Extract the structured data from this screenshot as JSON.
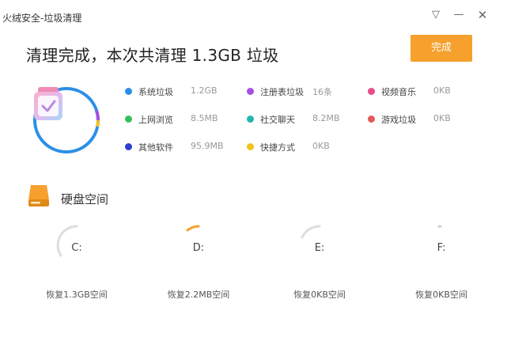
{
  "window": {
    "title": "火绒安全-垃圾清理",
    "menu_glyph": "▽",
    "minimize_glyph": "—",
    "close_glyph": "✕"
  },
  "summary": {
    "headline": "清理完成，本次共清理 1.3GB 垃圾",
    "done_label": "完成"
  },
  "categories": [
    {
      "label": "系统垃圾",
      "value": "1.2GB",
      "color": "#2b8fe8"
    },
    {
      "label": "注册表垃圾",
      "value": "16条",
      "color": "#a64fe3"
    },
    {
      "label": "视频音乐",
      "value": "0KB",
      "color": "#e84a8a"
    },
    {
      "label": "上网浏览",
      "value": "8.5MB",
      "color": "#34c15a"
    },
    {
      "label": "社交聊天",
      "value": "8.2MB",
      "color": "#23b6ad"
    },
    {
      "label": "游戏垃圾",
      "value": "0KB",
      "color": "#e45a5a"
    },
    {
      "label": "其他软件",
      "value": "95.9MB",
      "color": "#2f3fc9"
    },
    {
      "label": "快捷方式",
      "value": "0KB",
      "color": "#f2c21b"
    }
  ],
  "colors": {
    "accent": "#f6a02d",
    "ring_main": "#2b8fe8",
    "drive_track": "#dddddd",
    "drive_fill": "#f6a02d"
  },
  "disk": {
    "title": "硬盘空间",
    "drives": [
      {
        "letter": "C:",
        "recovered": "恢复1.3GB空间"
      },
      {
        "letter": "D:",
        "recovered": "恢复2.2MB空间"
      },
      {
        "letter": "E:",
        "recovered": "恢复0KB空间"
      },
      {
        "letter": "F:",
        "recovered": "恢复0KB空间"
      }
    ]
  }
}
